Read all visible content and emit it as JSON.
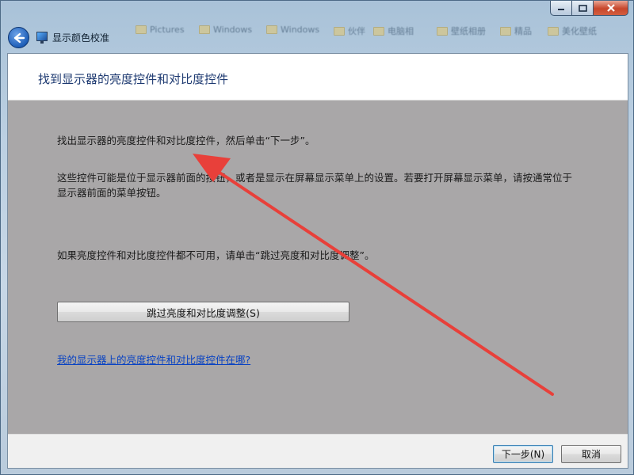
{
  "window": {
    "app_title": "显示颜色校准",
    "blurred_items": [
      "Pictures",
      "Windows",
      "Windows",
      "伙伴",
      "电脑相",
      "壁纸相册",
      "精品",
      "美化壁纸"
    ]
  },
  "header": {
    "title": "找到显示器的亮度控件和对比度控件"
  },
  "body": {
    "instruction": "找出显示器的亮度控件和对比度控件，然后单击“下一步”。",
    "description": "这些控件可能是位于显示器前面的按钮，或者是显示在屏幕显示菜单上的设置。若要打开屏幕显示菜单，请按通常位于显示器前面的菜单按钮。",
    "fallback": "如果亮度控件和对比度控件都不可用，请单击“跳过亮度和对比度调整”。",
    "skip_button": "跳过亮度和对比度调整(S)",
    "help_link": "我的显示器上的亮度控件和对比度控件在哪?"
  },
  "footer": {
    "next_button": "下一步(N)",
    "cancel_button": "取消"
  },
  "colors": {
    "content_bg": "#a9a7a8",
    "title_color": "#1f3b72",
    "link_color": "#0a43c2",
    "arrow_color": "#e8403a"
  }
}
